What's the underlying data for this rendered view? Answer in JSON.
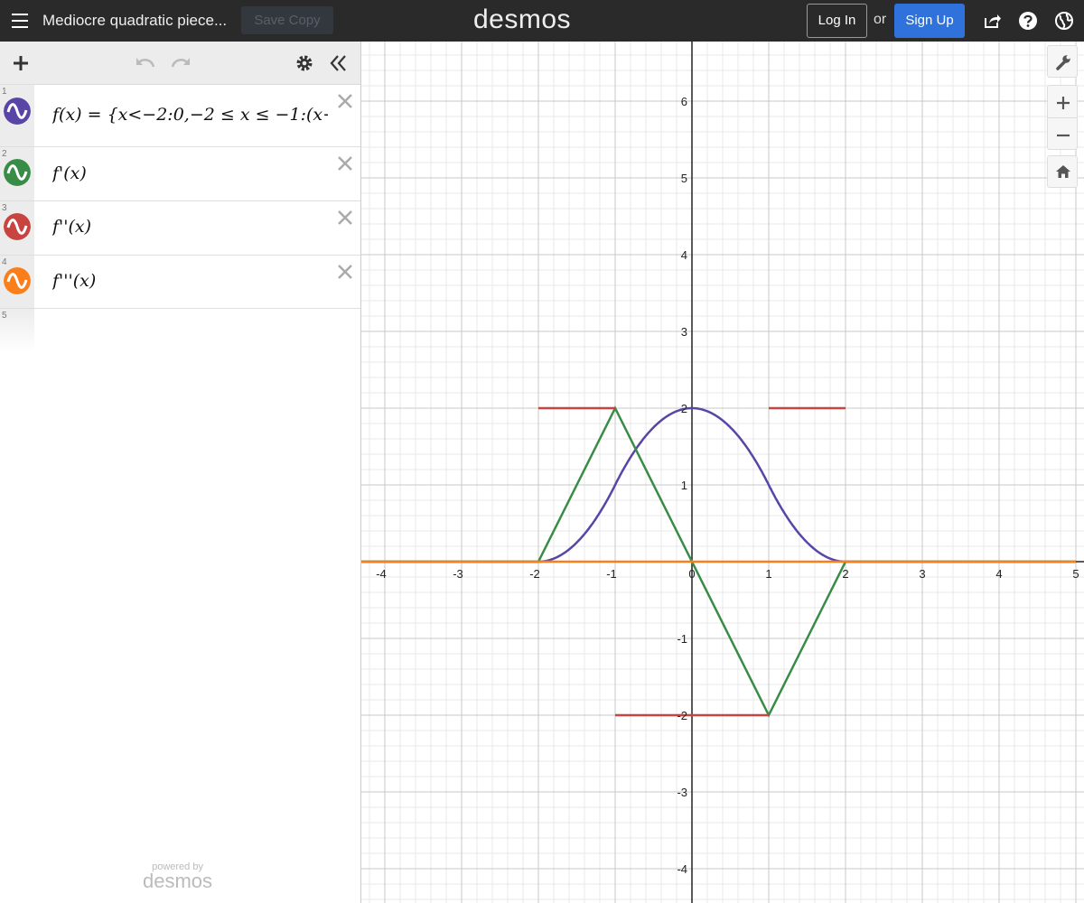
{
  "header": {
    "title": "Mediocre quadratic piece...",
    "save_copy": "Save Copy",
    "logo": "desmos",
    "login": "Log In",
    "or": "or",
    "signup": "Sign Up"
  },
  "expressions": [
    {
      "num": "1",
      "color": "#5945a6",
      "text": "f(x) = {x<−2:0,−2 ≤ x ≤ −1:(x+"
    },
    {
      "num": "2",
      "color": "#388c46",
      "text": "f'(x)"
    },
    {
      "num": "3",
      "color": "#c74440",
      "text": "f''(x)"
    },
    {
      "num": "4",
      "color": "#fa7e19",
      "text": "f'''(x)"
    },
    {
      "num": "5",
      "color": "",
      "text": ""
    }
  ],
  "powered": {
    "line1": "powered by",
    "line2": "desmos"
  },
  "chart_data": {
    "type": "line",
    "xlim": [
      -4.5,
      5.0
    ],
    "ylim": [
      -4.5,
      6.7
    ],
    "x_ticks": [
      "-4",
      "-3",
      "-2",
      "-1",
      "0",
      "1",
      "2",
      "3",
      "4",
      "5"
    ],
    "y_ticks": [
      "-4",
      "-3",
      "-2",
      "-1",
      "1",
      "2",
      "3",
      "4",
      "5",
      "6"
    ],
    "grid": true,
    "series": [
      {
        "color": "#5945a6",
        "points": [
          [
            -4.5,
            0
          ],
          [
            -2,
            0
          ],
          [
            -1.5,
            0.25
          ],
          [
            -1,
            1
          ],
          [
            -0.5,
            1.75
          ],
          [
            0,
            2
          ],
          [
            0.5,
            1.75
          ],
          [
            1,
            1
          ],
          [
            1.5,
            0.25
          ],
          [
            2,
            0
          ],
          [
            5,
            0
          ]
        ]
      },
      {
        "color": "#388c46",
        "points": [
          [
            -4.5,
            0
          ],
          [
            -2,
            0
          ],
          [
            -1,
            2
          ],
          [
            1,
            -2
          ],
          [
            2,
            0
          ],
          [
            5,
            0
          ]
        ]
      },
      {
        "color": "#c74440",
        "segments": [
          [
            [
              -2,
              2
            ],
            [
              -1,
              2
            ]
          ],
          [
            [
              -1,
              -2
            ],
            [
              1,
              -2
            ]
          ],
          [
            [
              1,
              2
            ],
            [
              2,
              2
            ]
          ]
        ]
      },
      {
        "color": "#fa7e19",
        "points": [
          [
            -4.5,
            0
          ],
          [
            5,
            0
          ]
        ]
      }
    ]
  }
}
